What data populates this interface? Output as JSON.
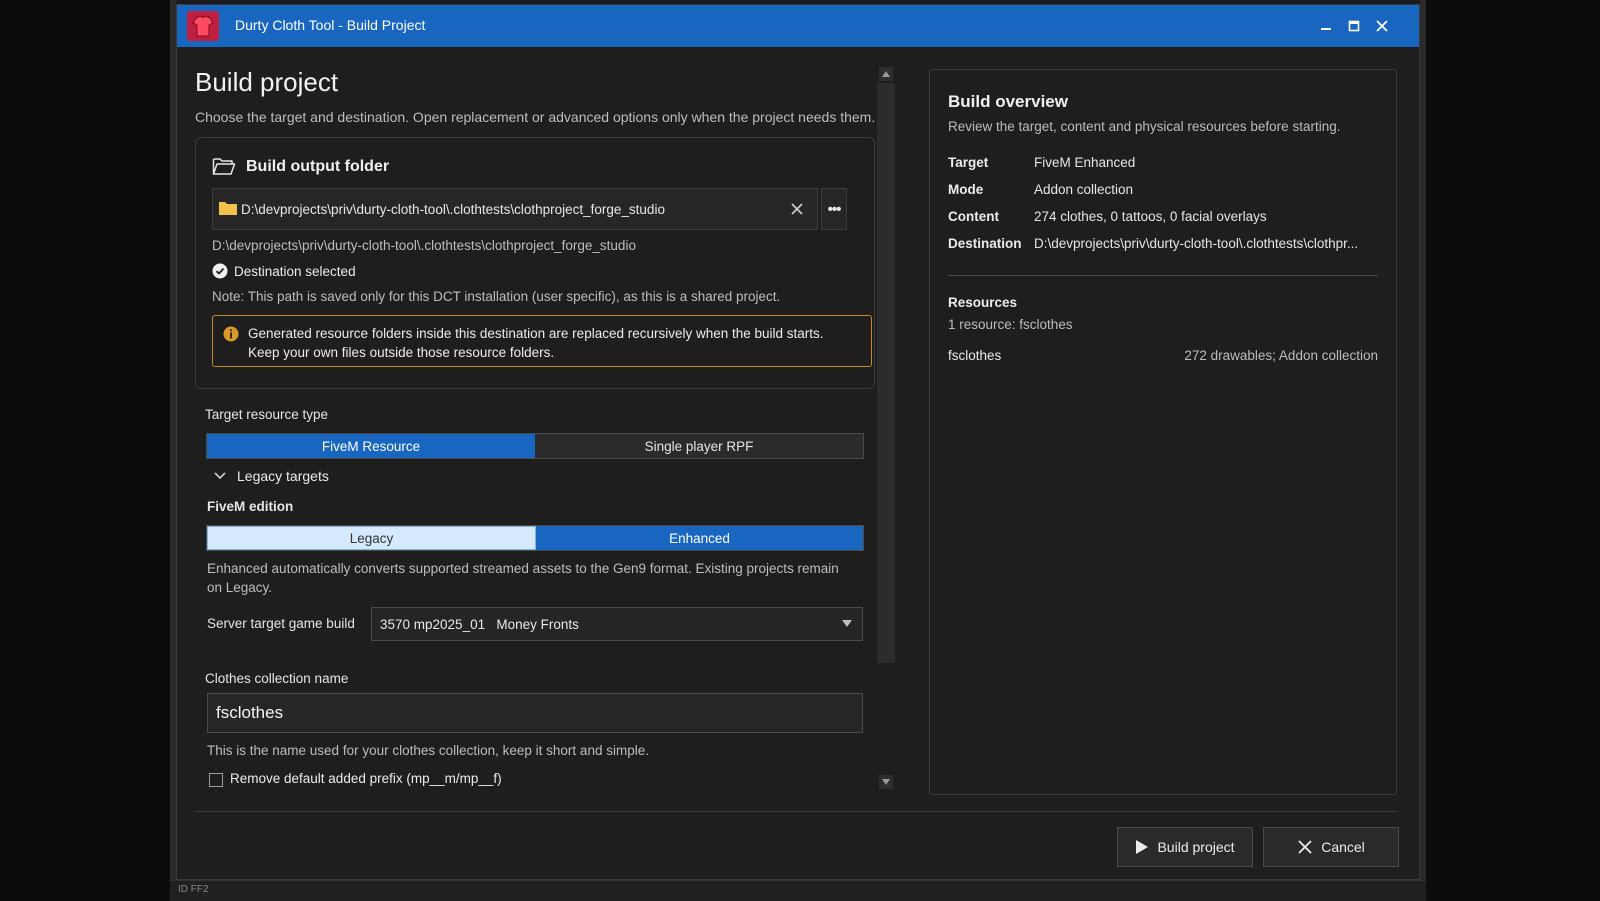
{
  "window": {
    "title": "Durty Cloth Tool - Build Project",
    "controls": [
      "minimize",
      "maximize",
      "close"
    ]
  },
  "page": {
    "title": "Build project",
    "subtitle": "Choose the target and destination. Open replacement or advanced options only when the project needs them."
  },
  "output_folder": {
    "heading": "Build output folder",
    "path_value": "D:\\devprojects\\priv\\durty-cloth-tool\\.clothtests\\clothproject_forge_studio",
    "path_echo": "D:\\devprojects\\priv\\durty-cloth-tool\\.clothtests\\clothproject_forge_studio",
    "status": "Destination selected",
    "note": "Note: This path is saved only for this DCT installation (user specific), as this is a shared project.",
    "warning_line1": "Generated resource folders inside this destination are replaced recursively when the build starts.",
    "warning_line2": "Keep your own files outside those resource folders.",
    "more_label": "•••"
  },
  "target_type": {
    "label": "Target resource type",
    "options": [
      "FiveM Resource",
      "Single player RPF"
    ],
    "selected": "FiveM Resource"
  },
  "legacy_targets": {
    "label": "Legacy targets",
    "expanded": true
  },
  "fivem_edition": {
    "label": "FiveM edition",
    "options": [
      "Legacy",
      "Enhanced"
    ],
    "selected": "Enhanced",
    "description": "Enhanced automatically converts supported streamed assets to the Gen9 format. Existing projects remain on Legacy."
  },
  "server_build": {
    "label": "Server target game build",
    "value": "3570 mp2025_01   Money Fronts"
  },
  "collection": {
    "label": "Clothes collection name",
    "value": "fsclothes",
    "hint": "This is the name used for your clothes collection, keep it short and simple.",
    "prefix_checkbox_label": "Remove default added prefix (mp__m/mp__f)",
    "prefix_checked": false
  },
  "overview": {
    "title": "Build overview",
    "subtitle": "Review the target, content and physical resources before starting.",
    "rows": [
      {
        "key": "Target",
        "value": "FiveM Enhanced"
      },
      {
        "key": "Mode",
        "value": "Addon collection"
      },
      {
        "key": "Content",
        "value": "274 clothes, 0 tattoos, 0 facial overlays"
      },
      {
        "key": "Destination",
        "value": "D:\\devprojects\\priv\\durty-cloth-tool\\.clothtests\\clothpr..."
      }
    ],
    "resources_title": "Resources",
    "resources_summary": "1 resource: fsclothes",
    "resource_name": "fsclothes",
    "resource_detail": "272 drawables; Addon collection"
  },
  "actions": {
    "build_label": "Build project",
    "cancel_label": "Cancel"
  },
  "colors": {
    "accent": "#1866c0",
    "warning_border": "#c98a25",
    "background": "#1e1e1e"
  },
  "background_app": {
    "status_text": "ID FF2"
  }
}
